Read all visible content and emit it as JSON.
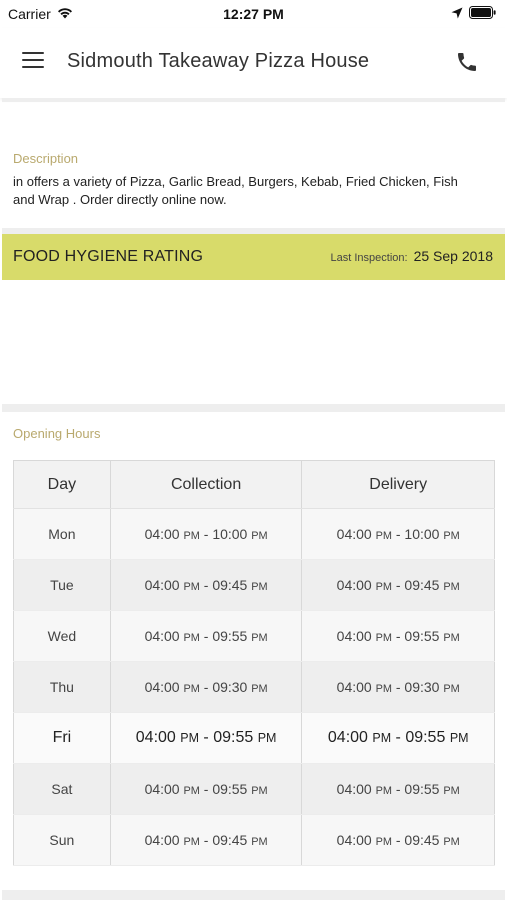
{
  "status_bar": {
    "carrier": "Carrier",
    "time": "12:27 PM"
  },
  "header": {
    "title": "Sidmouth Takeaway Pizza House"
  },
  "description": {
    "label": "Description",
    "text": "in  offers a variety of Pizza, Garlic Bread, Burgers, Kebab, Fried Chicken, Fish and Wrap . Order directly online now."
  },
  "hygiene": {
    "title": "FOOD HYGIENE RATING",
    "last_inspection_label": "Last Inspection:",
    "last_inspection_date": "25 Sep 2018",
    "accent_color": "#d8db6a"
  },
  "opening_hours": {
    "label": "Opening Hours",
    "columns": [
      "Day",
      "Collection",
      "Delivery"
    ],
    "rows": [
      {
        "day": "Mon",
        "collection": {
          "open": "04:00",
          "open_ampm": "PM",
          "close": "10:00",
          "close_ampm": "PM"
        },
        "delivery": {
          "open": "04:00",
          "open_ampm": "PM",
          "close": "10:00",
          "close_ampm": "PM"
        }
      },
      {
        "day": "Tue",
        "collection": {
          "open": "04:00",
          "open_ampm": "PM",
          "close": "09:45",
          "close_ampm": "PM"
        },
        "delivery": {
          "open": "04:00",
          "open_ampm": "PM",
          "close": "09:45",
          "close_ampm": "PM"
        }
      },
      {
        "day": "Wed",
        "collection": {
          "open": "04:00",
          "open_ampm": "PM",
          "close": "09:55",
          "close_ampm": "PM"
        },
        "delivery": {
          "open": "04:00",
          "open_ampm": "PM",
          "close": "09:55",
          "close_ampm": "PM"
        }
      },
      {
        "day": "Thu",
        "collection": {
          "open": "04:00",
          "open_ampm": "PM",
          "close": "09:30",
          "close_ampm": "PM"
        },
        "delivery": {
          "open": "04:00",
          "open_ampm": "PM",
          "close": "09:30",
          "close_ampm": "PM"
        }
      },
      {
        "day": "Fri",
        "collection": {
          "open": "04:00",
          "open_ampm": "PM",
          "close": "09:55",
          "close_ampm": "PM"
        },
        "delivery": {
          "open": "04:00",
          "open_ampm": "PM",
          "close": "09:55",
          "close_ampm": "PM"
        }
      },
      {
        "day": "Sat",
        "collection": {
          "open": "04:00",
          "open_ampm": "PM",
          "close": "09:55",
          "close_ampm": "PM"
        },
        "delivery": {
          "open": "04:00",
          "open_ampm": "PM",
          "close": "09:55",
          "close_ampm": "PM"
        }
      },
      {
        "day": "Sun",
        "collection": {
          "open": "04:00",
          "open_ampm": "PM",
          "close": "09:45",
          "close_ampm": "PM"
        },
        "delivery": {
          "open": "04:00",
          "open_ampm": "PM",
          "close": "09:45",
          "close_ampm": "PM"
        }
      }
    ],
    "highlighted_day": "Fri"
  }
}
